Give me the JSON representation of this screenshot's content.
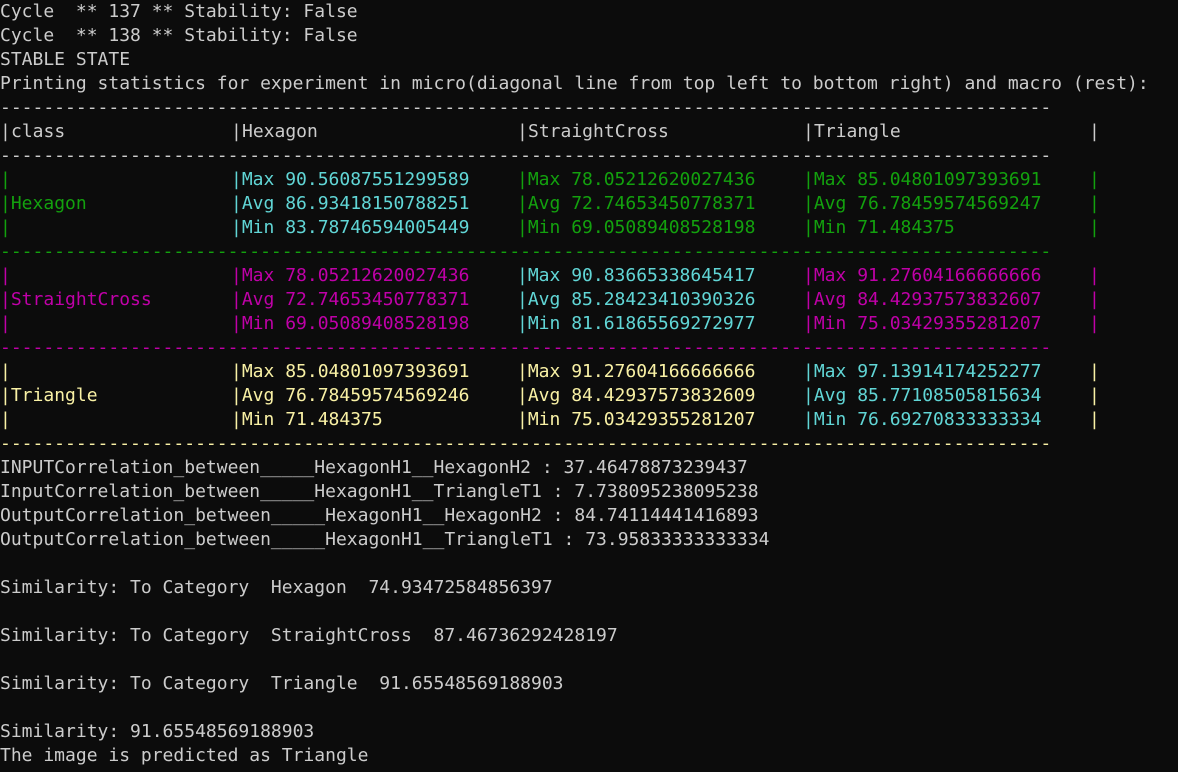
{
  "pre_lines": [
    "Cycle  ** 137 ** Stability: False",
    "Cycle  ** 138 ** Stability: False",
    "STABLE STATE",
    "Printing statistics for experiment in micro(diagonal line from top left to bottom right) and macro (rest):"
  ],
  "separator": "-------------------------------------------------------------------------------------------------",
  "table": {
    "header": [
      "class",
      "Hexagon",
      "StraightCross",
      "Triangle"
    ],
    "rows": [
      {
        "label": "Hexagon",
        "color": "#13a10e",
        "cells": [
          {
            "color": "#61d6d6",
            "max": "Max 90.56087551299589",
            "avg": "Avg 86.93418150788251",
            "min": "Min 83.78746594005449"
          },
          {
            "color": "#13a10e",
            "max": "Max 78.05212620027436",
            "avg": "Avg 72.74653450778371",
            "min": "Min 69.05089408528198"
          },
          {
            "color": "#13a10e",
            "max": "Max 85.04801097393691",
            "avg": "Avg 76.78459574569247",
            "min": "Min 71.484375"
          }
        ]
      },
      {
        "label": "StraightCross",
        "color": "#c000a8",
        "cells": [
          {
            "color": "#c000a8",
            "max": "Max 78.05212620027436",
            "avg": "Avg 72.74653450778371",
            "min": "Min 69.05089408528198"
          },
          {
            "color": "#61d6d6",
            "max": "Max 90.83665338645417",
            "avg": "Avg 85.28423410390326",
            "min": "Min 81.61865569272977"
          },
          {
            "color": "#c000a8",
            "max": "Max 91.27604166666666",
            "avg": "Avg 84.42937573832607",
            "min": "Min 75.03429355281207"
          }
        ]
      },
      {
        "label": "Triangle",
        "color": "#f9f1a5",
        "cells": [
          {
            "color": "#f9f1a5",
            "max": "Max 85.04801097393691",
            "avg": "Avg 76.78459574569246",
            "min": "Min 71.484375"
          },
          {
            "color": "#f9f1a5",
            "max": "Max 91.27604166666666",
            "avg": "Avg 84.42937573832609",
            "min": "Min 75.03429355281207"
          },
          {
            "color": "#61d6d6",
            "max": "Max 97.13914174252277",
            "avg": "Avg 85.77108505815634",
            "min": "Min 76.69270833333334"
          }
        ]
      }
    ]
  },
  "correlations": [
    "INPUTCorrelation_between_____HexagonH1__HexagonH2 : 37.46478873239437",
    "InputCorrelation_between_____HexagonH1__TriangleT1 : 7.738095238095238",
    "OutputCorrelation_between_____HexagonH1__HexagonH2 : 84.74114441416893",
    "OutputCorrelation_between_____HexagonH1__TriangleT1 : 73.95833333333334"
  ],
  "similarities": [
    "Similarity: To Category  Hexagon  74.93472584856397",
    "Similarity: To Category  StraightCross  87.46736292428197",
    "Similarity: To Category  Triangle  91.65548569188903"
  ],
  "final_similarity": "Similarity: 91.65548569188903",
  "prediction": "The image is predicted as Triangle"
}
